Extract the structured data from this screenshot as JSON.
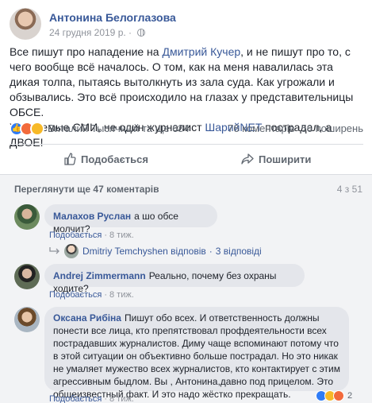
{
  "post": {
    "author": "Антонина Белоглазова",
    "date": "24 грудня 2019 р.",
    "privacy_icon": "globe-icon",
    "text_before_link1": "Все пишут про нападение на ",
    "link1": "Дмитрий Кучер",
    "text_after_link1": ", и не пишут про то, с чего вообще всё началось. О том, как на меня навалилась эта дикая толпа, пытаясь вытолкнуть из зала суда. Как угрожали и обзывались. Это всё происходило на глазах у представительницы ОБСЕ.",
    "text2_before_link": "Уважаемые СМИ, не один журналист ",
    "link2": "ШарийNET",
    "text2_after_link": " пострадал, а ДВОЕ!"
  },
  "stats": {
    "likers": "Виталий Тысячный та ще 684",
    "comments_count": "76 коментарів",
    "shares_count": "56 поширень",
    "reaction_icons": [
      "like-icon",
      "angry-icon",
      "sad-icon"
    ],
    "colors": {
      "like": "#2f7cf6",
      "angry": "#f26a3c",
      "sad": "#f7b928"
    }
  },
  "actions": {
    "like_label": "Подобається",
    "share_label": "Поширити"
  },
  "comments_section": {
    "more_label": "Переглянути ще 47 коментарів",
    "pager": "4 з 51",
    "comments": [
      {
        "name": "Малахов Руслан",
        "text": "а шо обсе молчит?",
        "like_label": "Подобається",
        "time": "8 тиж.",
        "reply_user": "Dmitriy Temchyshen відповів",
        "reply_count": "3 відповіді"
      },
      {
        "name": "Andrej Zimmermann",
        "text": "Реально, почему без охраны ходите?",
        "like_label": "Подобається",
        "time": "8 тиж."
      },
      {
        "name": "Оксана Рибіна",
        "text": "Пишут обо всех. И ответственность должны понести все лица, кто препятствовал профдеятельности всех пострадавших журналистов. Диму чаще вспоминают потому что в этой ситуации он объективно больше пострадал. Но это никак не умаляет мужество всех журналистов, кто контактирует с этим агрессивным быдлом. Вы , Антонина,давно под прицелом. Это общеизвестный факт. И это надо жёстко прекращать.",
        "like_label": "Подобається",
        "time": "8 тиж.",
        "reaction_count": "2"
      }
    ]
  },
  "colors": {
    "link": "#385898",
    "meta": "#90949c",
    "bubble": "#e4e6eb",
    "comments_bg": "#f2f3f5"
  }
}
